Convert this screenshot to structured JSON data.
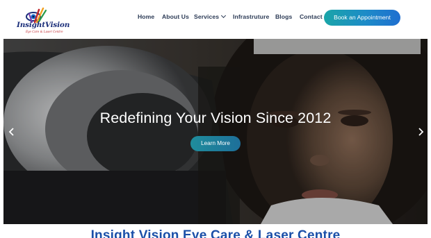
{
  "brand": {
    "name": "InsightVision",
    "tagline": "Eye Care & Laser Centre"
  },
  "nav": {
    "items": [
      {
        "label": "Home"
      },
      {
        "label": "About Us"
      },
      {
        "label": "Services"
      },
      {
        "label": "Infrastruture"
      },
      {
        "label": "Blogs"
      },
      {
        "label": "Contact"
      }
    ],
    "cta_label": "Book an Appointment"
  },
  "hero": {
    "title": "Redefining Your Vision Since 2012",
    "button_label": "Learn More",
    "prev_icon": "chevron-left-icon",
    "next_icon": "chevron-right-icon"
  },
  "section": {
    "title": "Insight Vision Eye Care & Laser Centre"
  },
  "colors": {
    "nav_text": "#2b3a55",
    "cta_gradient_start": "#1aa5a8",
    "cta_gradient_end": "#1f6fd0",
    "section_title": "#1a4fa8",
    "brand_red": "#c0272d",
    "brand_navy": "#1b2f7a"
  }
}
